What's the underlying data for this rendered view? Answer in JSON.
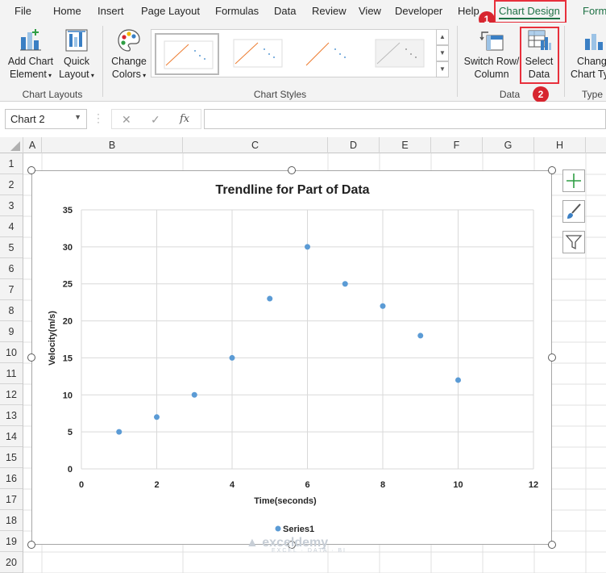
{
  "ribbon_tabs": {
    "file": "File",
    "home": "Home",
    "insert": "Insert",
    "page_layout": "Page Layout",
    "formulas": "Formulas",
    "data": "Data",
    "review": "Review",
    "view": "View",
    "developer": "Developer",
    "help": "Help",
    "chart_design": "Chart Design",
    "format": "Form"
  },
  "ribbon": {
    "add_chart_element": [
      "Add Chart",
      "Element"
    ],
    "quick_layout": [
      "Quick",
      "Layout"
    ],
    "change_colors": [
      "Change",
      "Colors"
    ],
    "switch_row_column": [
      "Switch Row/",
      "Column"
    ],
    "select_data": [
      "Select",
      "Data"
    ],
    "change_chart_type": [
      "Change",
      "Chart Typ"
    ],
    "groups": {
      "chart_layouts": "Chart Layouts",
      "chart_styles": "Chart Styles",
      "data": "Data",
      "type": "Type"
    }
  },
  "annotations": {
    "badge1": "1",
    "badge2": "2",
    "accent": "#e8303c"
  },
  "formula_bar": {
    "name_box": "Chart 2",
    "fx": "fx",
    "value": ""
  },
  "sheet": {
    "columns": [
      "A",
      "B",
      "C",
      "D",
      "E",
      "F",
      "G",
      "H"
    ],
    "rows": [
      "1",
      "2",
      "3",
      "4",
      "5",
      "6",
      "7",
      "8",
      "9",
      "10",
      "11",
      "12",
      "13",
      "14",
      "15",
      "16",
      "17",
      "18",
      "19",
      "20"
    ]
  },
  "chart_data": {
    "type": "scatter",
    "title": "Trendline for Part of Data",
    "xlabel": "Time(seconds)",
    "ylabel": "Velocity(m/s)",
    "xlim": [
      0,
      12
    ],
    "ylim": [
      0,
      35
    ],
    "xticks": [
      0,
      2,
      4,
      6,
      8,
      10,
      12
    ],
    "yticks": [
      0,
      5,
      10,
      15,
      20,
      25,
      30,
      35
    ],
    "grid": true,
    "legend_position": "bottom",
    "marker_color": "#5b9bd5",
    "series": [
      {
        "name": "Series1",
        "x": [
          1,
          2,
          3,
          4,
          5,
          6,
          7,
          8,
          9,
          10
        ],
        "y": [
          5,
          7,
          10,
          15,
          23,
          30,
          25,
          22,
          18,
          12
        ]
      }
    ]
  },
  "watermark": {
    "main": "exceldemy",
    "sub": "EXCEL · DATA · BI"
  }
}
